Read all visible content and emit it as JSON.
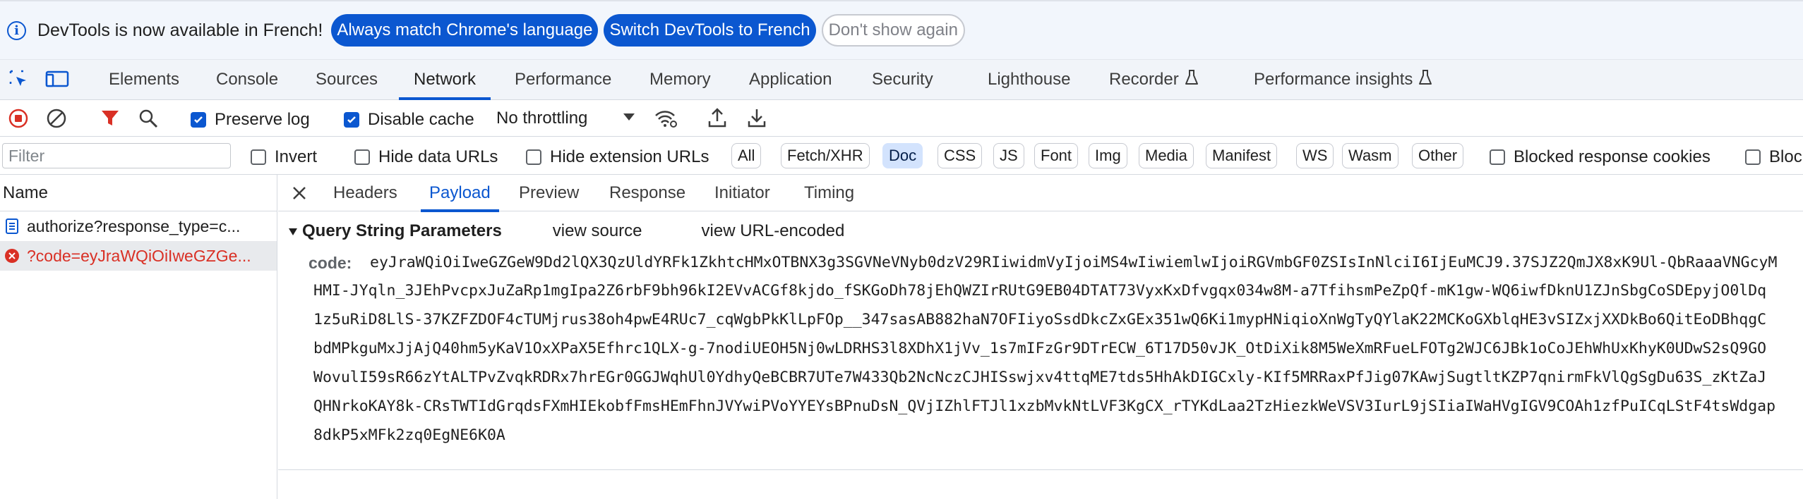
{
  "infobar": {
    "message": "DevTools is now available in French!",
    "btn_match": "Always match Chrome's language",
    "btn_switch": "Switch DevTools to French",
    "btn_dismiss": "Don't show again"
  },
  "tabs": {
    "elements": "Elements",
    "console": "Console",
    "sources": "Sources",
    "network": "Network",
    "performance": "Performance",
    "memory": "Memory",
    "application": "Application",
    "security": "Security",
    "lighthouse": "Lighthouse",
    "recorder": "Recorder",
    "performance_insights": "Performance insights"
  },
  "toolbar": {
    "preserve_log": "Preserve log",
    "disable_cache": "Disable cache",
    "throttling": "No throttling"
  },
  "filterbar": {
    "placeholder": "Filter",
    "invert": "Invert",
    "hide_data_urls": "Hide data URLs",
    "hide_extension_urls": "Hide extension URLs",
    "chips": {
      "all": "All",
      "fetch": "Fetch/XHR",
      "doc": "Doc",
      "css": "CSS",
      "js": "JS",
      "font": "Font",
      "img": "Img",
      "media": "Media",
      "manifest": "Manifest",
      "ws": "WS",
      "wasm": "Wasm",
      "other": "Other"
    },
    "blocked_cookies": "Blocked response cookies",
    "blocked_partial": "Bloc"
  },
  "requests": {
    "header": "Name",
    "items": [
      {
        "label": "authorize?response_type=c..."
      },
      {
        "label": "?code=eyJraWQiOiIweGZGe..."
      }
    ]
  },
  "detail": {
    "tabs": {
      "headers": "Headers",
      "payload": "Payload",
      "preview": "Preview",
      "response": "Response",
      "initiator": "Initiator",
      "timing": "Timing"
    },
    "section_title": "Query String Parameters",
    "view_source": "view source",
    "view_url_encoded": "view URL-encoded",
    "param_name": "code:",
    "param_lines": [
      "eyJraWQiOiIweGZGeW9Dd2lQX3QzUldYRFk1ZkhtcHMxOTBNX3g3SGVNeVNyb0dzV29RIiwidmVyIjoiMS4wIiwiemlwIjoiRGVmbGF0ZSIsInNlciI6IjEuMCJ9.37SJZ2QmJX8xK9Ul-QbRaaaVNGcyM",
      "HMI-JYqln_3JEhPvcpxJuZaRp1mgIpa2Z6rbF9bh96kI2EVvACGf8kjdo_fSKGoDh78jEhQWZIrRUtG9EB04DTAT73VyxKxDfvgqx034w8M-a7TfihsmPeZpQf-mK1gw-WQ6iwfDknU1ZJnSbgCoSDEpyjO0lDq",
      "1z5uRiD8LlS-37KZFZDOF4cTUMjrus38oh4pwE4RUc7_cqWgbPkKlLpFOp__347sasAB882haN7OFIiyoSsdDkcZxGEx351wQ6Ki1mypHNiqioXnWgTyQYlaK22MCKoGXblqHE3vSIZxjXXDkBo6QitEoDBhqgC",
      "bdMPkguMxJjAjQ40hm5yKaV1OxXPaX5Efhrc1QLX-g-7nodiUEOH5Nj0wLDRHS3l8XDhX1jVv_1s7mIFzGr9DTrECW_6T17D50vJK_OtDiXik8M5WeXmRFueLFOTg2WJC6JBk1oCoJEhWhUxKhyK0UDwS2sQ9GO",
      "WovulI59sR66zYtALTPvZvqkRDRx7hrEGr0GGJWqhUl0YdhyQeBCBR7UTe7W433Qb2NcNczCJHISswjxv4ttqME7tds5HhAkDIGCxly-KIf5MRRaxPfJig07KAwjSugtltKZP7qnirmFkVlQgSgDu63S_zKtZaJ",
      "QHNrkoKAY8k-CRsTWTIdGrqdsFXmHIEkobfFmsHEmFhnJVYwiPVoYYEYsBPnuDsN_QVjIZhlFTJl1xzbMvkNtLVF3KgCX_rTYKdLaa2TzHiezkWeVSV3IurL9jSIiaIWaHVgIGV9COAh1zfPuICqLStF4tsWdgap",
      "8dkP5xMFk2zq0EgNE6K0A"
    ]
  }
}
